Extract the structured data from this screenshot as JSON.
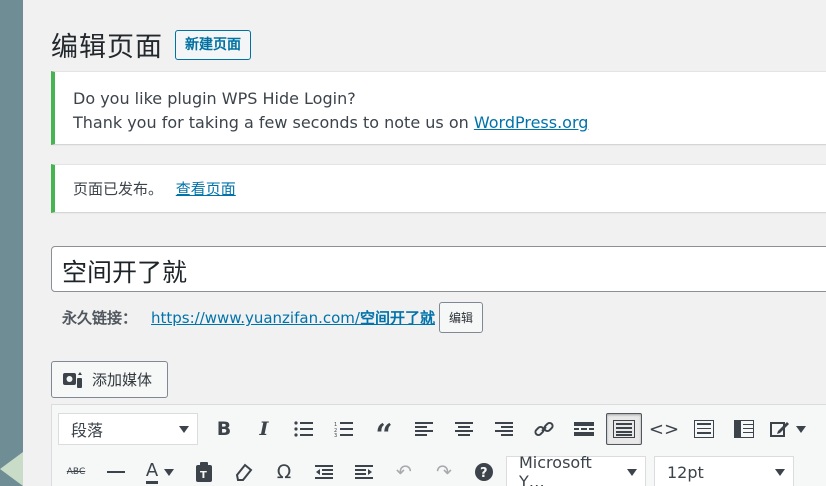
{
  "header": {
    "title": "编辑页面",
    "add_new_label": "新建页面"
  },
  "notices": {
    "rate": {
      "line1": "Do you like plugin WPS Hide Login?",
      "line2_prefix": "Thank you for taking a few seconds to note us on ",
      "line2_link": "WordPress.org"
    },
    "published": {
      "text": "页面已发布。",
      "link": "查看页面"
    }
  },
  "post_title": {
    "value": "空间开了就"
  },
  "permalink": {
    "label": "永久链接：",
    "url_base": "https://www.yuanzifan.com/",
    "slug": "空间开了就",
    "edit_label": "编辑"
  },
  "media": {
    "add_label": "添加媒体"
  },
  "toolbar": {
    "format_select": "段落",
    "font_family": "Microsoft Y…",
    "font_size": "12pt",
    "strike_label": "ABC",
    "text_color_label": "A",
    "icons_row1": [
      "bold-icon",
      "italic-icon",
      "bullet-list-icon",
      "numbered-list-icon",
      "blockquote-icon",
      "align-left-icon",
      "align-center-icon",
      "align-right-icon",
      "link-icon",
      "read-more-icon",
      "toolbar-toggle-icon",
      "code-icon",
      "table-icon",
      "columns-icon",
      "edit-icon"
    ],
    "icons_row2": [
      "strikethrough-icon",
      "horizontal-rule-icon",
      "text-color-icon",
      "paste-text-icon",
      "clear-formatting-icon",
      "special-char-icon",
      "outdent-icon",
      "indent-icon",
      "undo-icon",
      "redo-icon",
      "help-icon"
    ]
  },
  "colors": {
    "accent": "#0073aa",
    "notice_success": "#46b450",
    "sidebar": "#6f8d94"
  }
}
